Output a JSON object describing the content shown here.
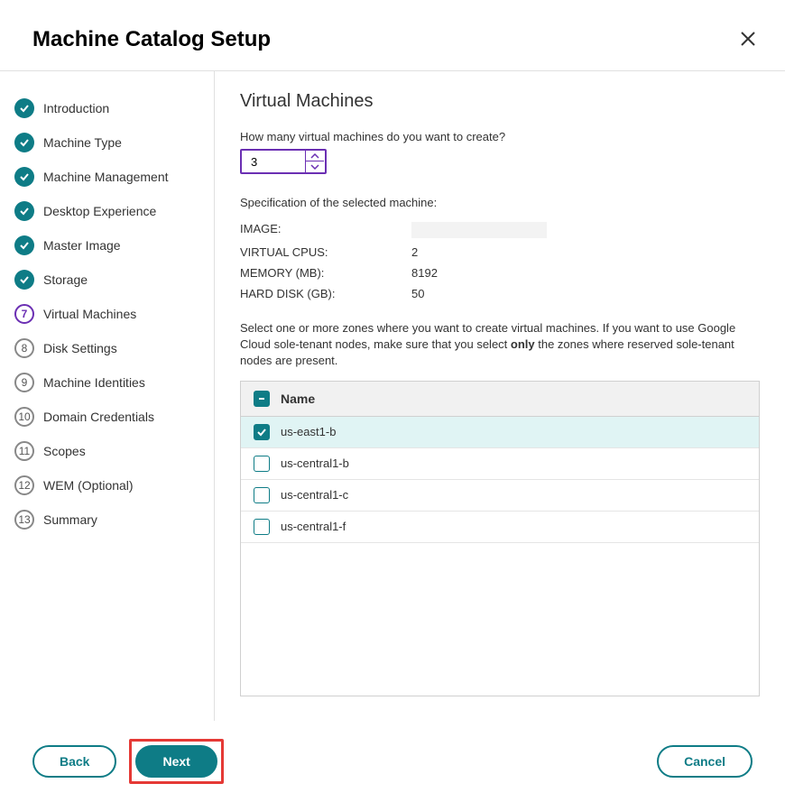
{
  "header": {
    "title": "Machine Catalog Setup"
  },
  "sidebar": {
    "items": [
      {
        "label": "Introduction",
        "state": "done"
      },
      {
        "label": "Machine Type",
        "state": "done"
      },
      {
        "label": "Machine Management",
        "state": "done"
      },
      {
        "label": "Desktop Experience",
        "state": "done"
      },
      {
        "label": "Master Image",
        "state": "done"
      },
      {
        "label": "Storage",
        "state": "done"
      },
      {
        "label": "Virtual Machines",
        "state": "current",
        "num": "7"
      },
      {
        "label": "Disk Settings",
        "state": "pending",
        "num": "8"
      },
      {
        "label": "Machine Identities",
        "state": "pending",
        "num": "9"
      },
      {
        "label": "Domain Credentials",
        "state": "pending",
        "num": "10"
      },
      {
        "label": "Scopes",
        "state": "pending",
        "num": "11"
      },
      {
        "label": "WEM (Optional)",
        "state": "pending",
        "num": "12"
      },
      {
        "label": "Summary",
        "state": "pending",
        "num": "13"
      }
    ]
  },
  "main": {
    "title": "Virtual Machines",
    "question": "How many virtual machines do you want to create?",
    "vm_count": "3",
    "spec_title": "Specification of the selected machine:",
    "specs": {
      "image_label": "IMAGE:",
      "image_value": "",
      "vcpu_label": "VIRTUAL CPUS:",
      "vcpu_value": "2",
      "memory_label": "MEMORY (MB):",
      "memory_value": "8192",
      "disk_label": "HARD DISK (GB):",
      "disk_value": "50"
    },
    "zones_instruction_pre": "Select one or more zones where you want to create virtual machines. If you want to use Google Cloud sole-tenant nodes, make sure that you select ",
    "zones_instruction_bold": "only",
    "zones_instruction_post": " the zones where reserved sole-tenant nodes are present.",
    "zone_header": "Name",
    "zones": [
      {
        "name": "us-east1-b",
        "checked": true
      },
      {
        "name": "us-central1-b",
        "checked": false
      },
      {
        "name": "us-central1-c",
        "checked": false
      },
      {
        "name": "us-central1-f",
        "checked": false
      }
    ]
  },
  "footer": {
    "back": "Back",
    "next": "Next",
    "cancel": "Cancel"
  }
}
